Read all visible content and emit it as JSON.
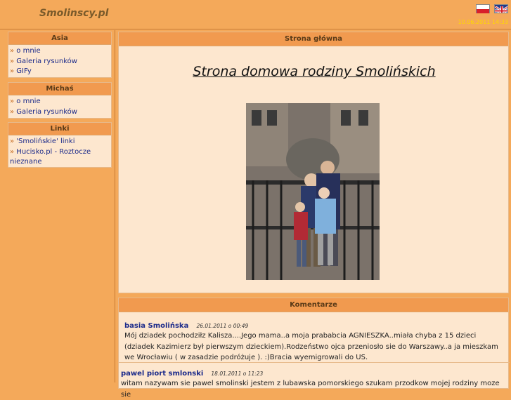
{
  "header": {
    "site_title": "Smolinscy.pl",
    "datetime": "10.06.2011 14:33"
  },
  "flags": [
    {
      "name": "polish-flag"
    },
    {
      "name": "english-flag"
    }
  ],
  "sidebar": {
    "boxes": [
      {
        "title": "Asia",
        "items": [
          {
            "label": "o mnie"
          },
          {
            "label": "Galeria rysunków"
          },
          {
            "label": "GIFy"
          }
        ]
      },
      {
        "title": "Michaś",
        "items": [
          {
            "label": "o mnie"
          },
          {
            "label": "Galeria rysunków"
          }
        ]
      },
      {
        "title": "Linki",
        "items": [
          {
            "label": "'Smolińskie' linki"
          },
          {
            "label": "Hucisko.pl - Roztocze nieznane"
          }
        ]
      }
    ]
  },
  "main": {
    "panel_title": "Strona główna",
    "welcome": "Strona domowa rodziny Smolińskich",
    "comments_title": "Komentarze",
    "comments": [
      {
        "author": "basia Smolińska",
        "date": "26.01.2011 o 00:49",
        "text": "Mój dziadek pochodziłz Kalisza....Jego mama..a moja prababcia AGNIESZKA..miała chyba z 15 dzieci (dziadek Kazimierz był pierwszym dzieckiem).Rodzeństwo ojca przeniosło sie do Warszawy..a ja mieszkam we Wrocławiu ( w zasadzie podróżuje ). :)Bracia wyemigrowali do US."
      },
      {
        "author": "pawel piort smlonski",
        "date": "18.01.2011 o 11:23",
        "text": "witam nazywam sie pawel smolinski jestem z lubawska pomorskiego szukam przodkow mojej rodziny moze sie"
      }
    ]
  },
  "colors": {
    "background": "#f4a95a",
    "box_bg": "#fde7cf",
    "box_head": "#f19a4f",
    "link": "#1b2a8a",
    "date": "#ffd800"
  }
}
